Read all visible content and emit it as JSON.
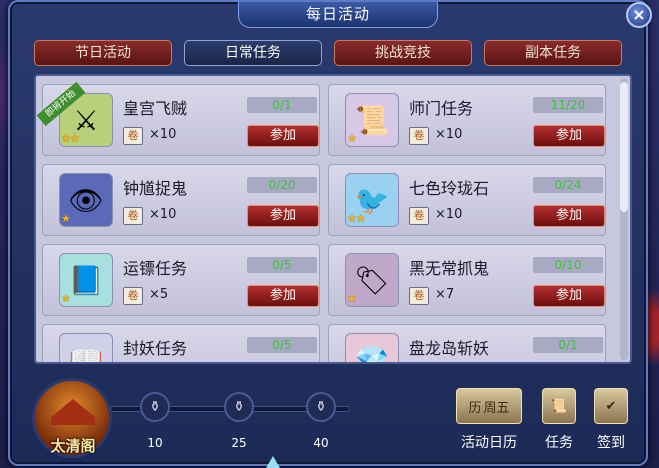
{
  "window": {
    "title": "每日活动"
  },
  "tabs": [
    {
      "label": "节日活动"
    },
    {
      "label": "日常任务"
    },
    {
      "label": "挑战竞技"
    },
    {
      "label": "副本任务"
    }
  ],
  "activities": [
    {
      "name": "皇宫飞贼",
      "progress": "0/1",
      "reward_count": "×10",
      "button": "参加",
      "badge": "即将开始",
      "icon": "sword-icon",
      "stars": 2
    },
    {
      "name": "师门任务",
      "progress": "11/20",
      "reward_count": "×10",
      "button": "参加",
      "icon": "scroll-icon",
      "stars": 1
    },
    {
      "name": "钟馗捉鬼",
      "progress": "0/20",
      "reward_count": "×10",
      "button": "参加",
      "icon": "ghost-banner-icon",
      "stars": 1
    },
    {
      "name": "七色玲珑石",
      "progress": "0/24",
      "reward_count": "×10",
      "button": "参加",
      "icon": "toucan-icon",
      "stars": 2
    },
    {
      "name": "运镖任务",
      "progress": "0/5",
      "reward_count": "×5",
      "button": "参加",
      "icon": "book-icon",
      "stars": 1
    },
    {
      "name": "黑无常抓鬼",
      "progress": "0/10",
      "reward_count": "×7",
      "button": "参加",
      "icon": "tag-icon",
      "stars": 1
    },
    {
      "name": "封妖任务",
      "progress": "0/5",
      "icon": "book-icon"
    },
    {
      "name": "盘龙岛斩妖",
      "progress": "0/1",
      "icon": "treasure-icon"
    }
  ],
  "footer": {
    "building_label": "太清阁",
    "milestones": [
      "10",
      "25",
      "40"
    ],
    "calendar_text": "周五",
    "calendar_label": "活动日历",
    "task_label": "任务",
    "signin_label": "签到"
  }
}
